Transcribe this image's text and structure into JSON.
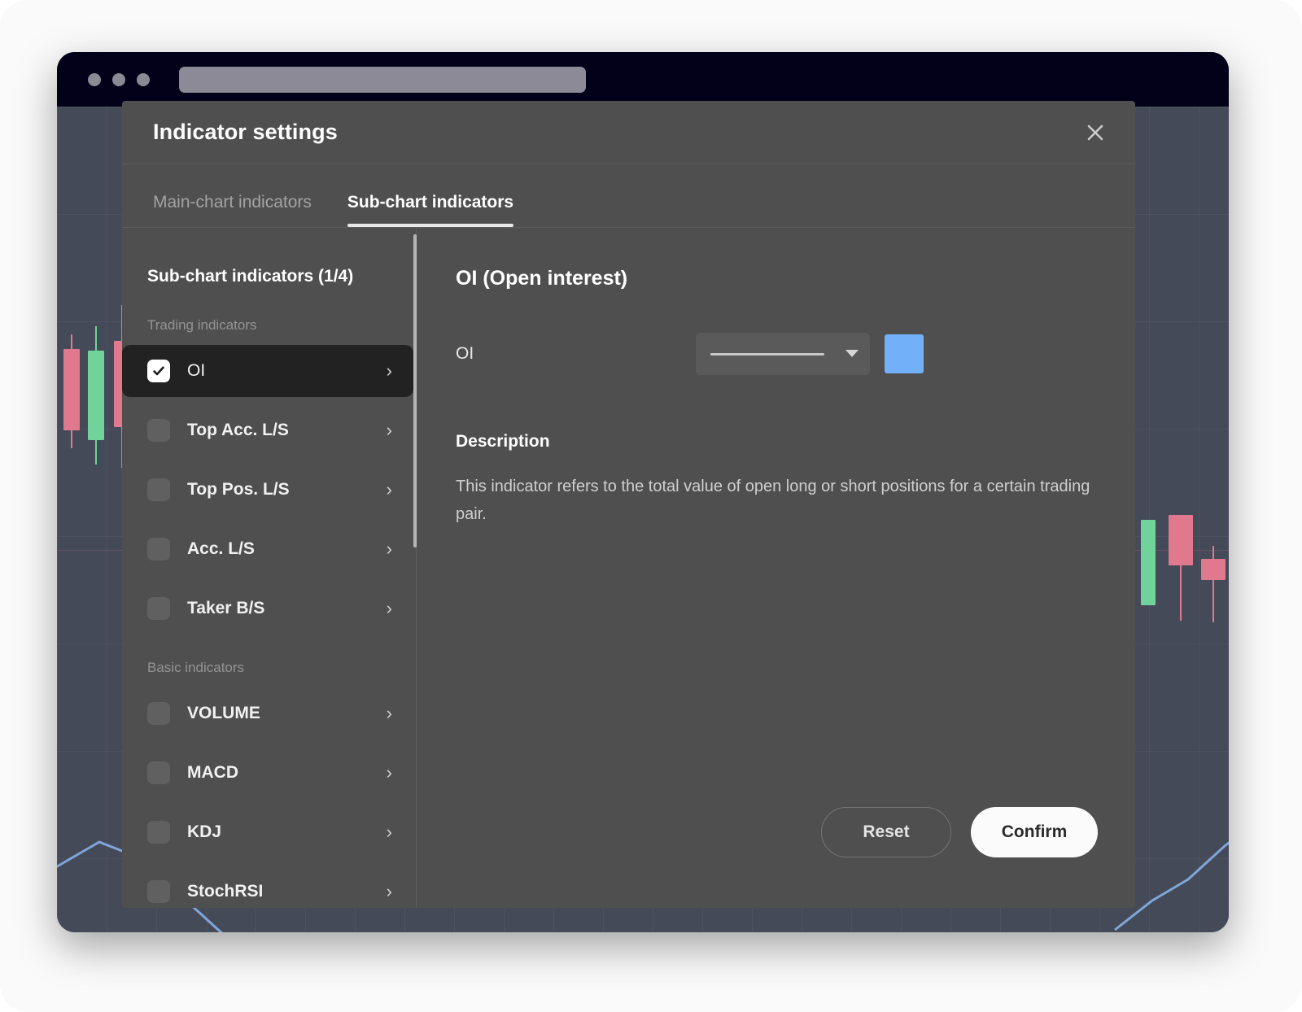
{
  "browser": {
    "traffic_lights": [
      "close-dot",
      "minimize-dot",
      "maximize-dot"
    ],
    "address_bar_value": ""
  },
  "modal": {
    "title": "Indicator settings",
    "close_label": "✕",
    "tabs": [
      {
        "label": "Main-chart indicators",
        "active": false
      },
      {
        "label": "Sub-chart indicators",
        "active": true
      }
    ]
  },
  "sidebar": {
    "heading": "Sub-chart indicators (1/4)",
    "groups": [
      {
        "label": "Trading indicators",
        "items": [
          {
            "label": "OI",
            "checked": true,
            "selected": true,
            "arrow": "›"
          },
          {
            "label": "Top Acc. L/S",
            "checked": false,
            "selected": false,
            "arrow": "›"
          },
          {
            "label": "Top Pos. L/S",
            "checked": false,
            "selected": false,
            "arrow": "›"
          },
          {
            "label": "Acc. L/S",
            "checked": false,
            "selected": false,
            "arrow": "›"
          },
          {
            "label": "Taker B/S",
            "checked": false,
            "selected": false,
            "arrow": "›"
          }
        ]
      },
      {
        "label": "Basic indicators",
        "items": [
          {
            "label": "VOLUME",
            "checked": false,
            "selected": false,
            "arrow": "›"
          },
          {
            "label": "MACD",
            "checked": false,
            "selected": false,
            "arrow": "›"
          },
          {
            "label": "KDJ",
            "checked": false,
            "selected": false,
            "arrow": "›"
          },
          {
            "label": "StochRSI",
            "checked": false,
            "selected": false,
            "arrow": "›"
          }
        ]
      }
    ]
  },
  "detail": {
    "title": "OI (Open interest)",
    "field_label": "OI",
    "line_style": "solid",
    "line_style_chevron": "▾",
    "color": "#73b0fa",
    "description_title": "Description",
    "description_text": "This indicator refers to the total value of open long or short positions for a certain trading pair.",
    "reset_label": "Reset",
    "confirm_label": "Confirm"
  },
  "colors": {
    "page_background": "#fafafa",
    "browser_chrome": "#03011a",
    "chart_background": "#454a59",
    "modal_background": "#4f4f4f",
    "selected_item_background": "#222222",
    "accent_blue": "#73b0fa",
    "candle_up": "#6fd39a",
    "candle_down": "#e0788e",
    "confirm_button": "#fbfbfb"
  }
}
